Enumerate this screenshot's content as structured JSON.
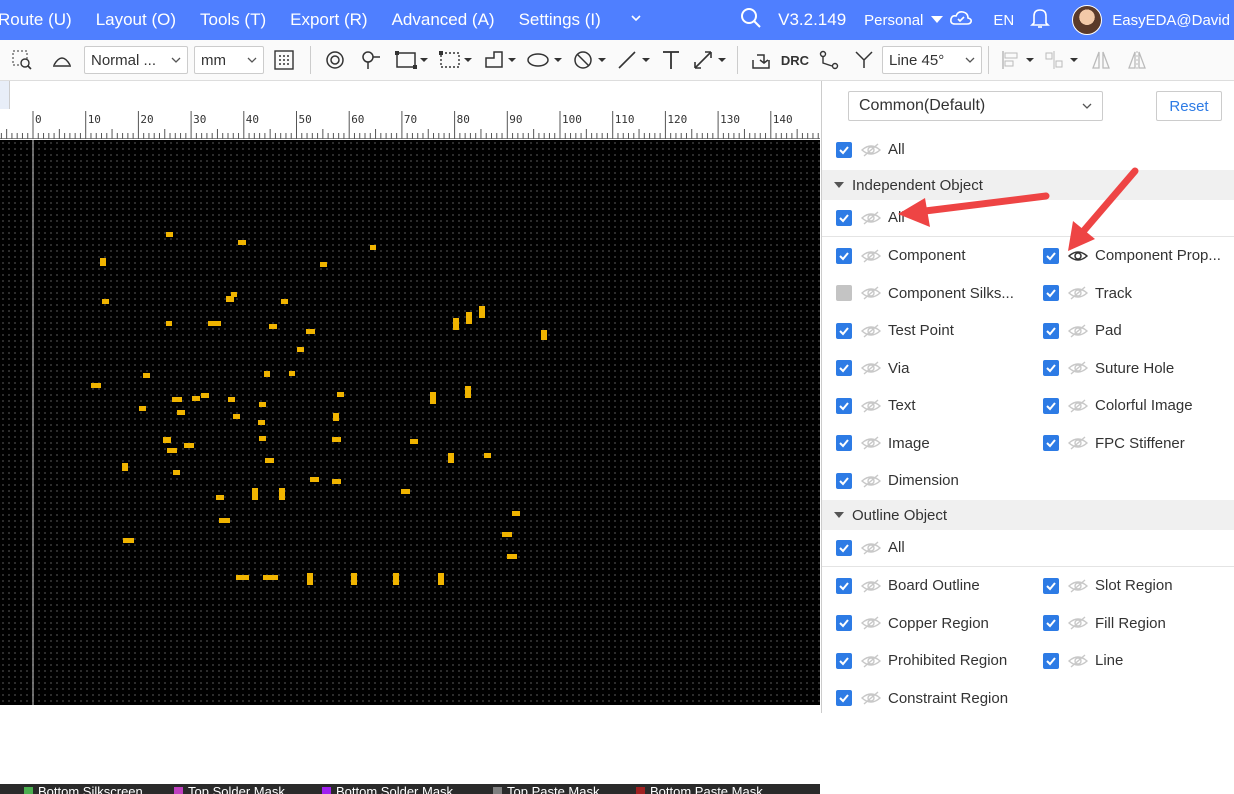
{
  "menu": {
    "items": [
      "Route (U)",
      "Layout (O)",
      "Tools (T)",
      "Export (R)",
      "Advanced (A)",
      "Settings (I)"
    ],
    "version": "V3.2.149",
    "plan": "Personal",
    "language": "EN",
    "user": "EasyEDA@David"
  },
  "toolbar": {
    "mode_select": "Normal ...",
    "unit_select": "mm",
    "drc_label": "DRC",
    "route_angle_select": "Line 45°"
  },
  "ruler": {
    "ticks": [
      "0",
      "10",
      "20",
      "30",
      "40",
      "50",
      "60",
      "70",
      "80",
      "90",
      "100",
      "110",
      "120",
      "130",
      "140"
    ]
  },
  "layers": [
    {
      "name": "Bottom Silkscreen",
      "color": "#4caf50"
    },
    {
      "name": "Top Solder Mask",
      "color": "#c040c0"
    },
    {
      "name": "Bottom Solder Mask",
      "color": "#a020f0"
    },
    {
      "name": "Top Paste Mask",
      "color": "#808080"
    },
    {
      "name": "Bottom Paste Mask",
      "color": "#a02020"
    }
  ],
  "panel": {
    "preset": "Common(Default)",
    "reset_label": "Reset",
    "all_label": "All",
    "independent_title": "Independent Object",
    "independent_all": "All",
    "independent_items": [
      {
        "label": "Component",
        "checked": true,
        "visible": false
      },
      {
        "label": "Component Prop...",
        "checked": true,
        "visible": true
      },
      {
        "label": "Component Silks...",
        "checked": false,
        "visible": false
      },
      {
        "label": "Track",
        "checked": true,
        "visible": false
      },
      {
        "label": "Test Point",
        "checked": true,
        "visible": false
      },
      {
        "label": "Pad",
        "checked": true,
        "visible": false
      },
      {
        "label": "Via",
        "checked": true,
        "visible": false
      },
      {
        "label": "Suture Hole",
        "checked": true,
        "visible": false
      },
      {
        "label": "Text",
        "checked": true,
        "visible": false
      },
      {
        "label": "Colorful Image",
        "checked": true,
        "visible": false
      },
      {
        "label": "Image",
        "checked": true,
        "visible": false
      },
      {
        "label": "FPC Stiffener",
        "checked": true,
        "visible": false
      },
      {
        "label": "Dimension",
        "checked": true,
        "visible": false
      }
    ],
    "outline_title": "Outline Object",
    "outline_all": "All",
    "outline_items": [
      {
        "label": "Board Outline",
        "checked": true
      },
      {
        "label": "Slot Region",
        "checked": true
      },
      {
        "label": "Copper Region",
        "checked": true
      },
      {
        "label": "Fill Region",
        "checked": true
      },
      {
        "label": "Prohibited Region",
        "checked": true
      },
      {
        "label": "Line",
        "checked": true
      },
      {
        "label": "Constraint Region",
        "checked": true
      }
    ]
  },
  "colors": {
    "menubar": "#4f7fff",
    "checkbox": "#2d7be5",
    "component_marks": "#f0b400",
    "annotation_arrow": "#ee4444"
  }
}
